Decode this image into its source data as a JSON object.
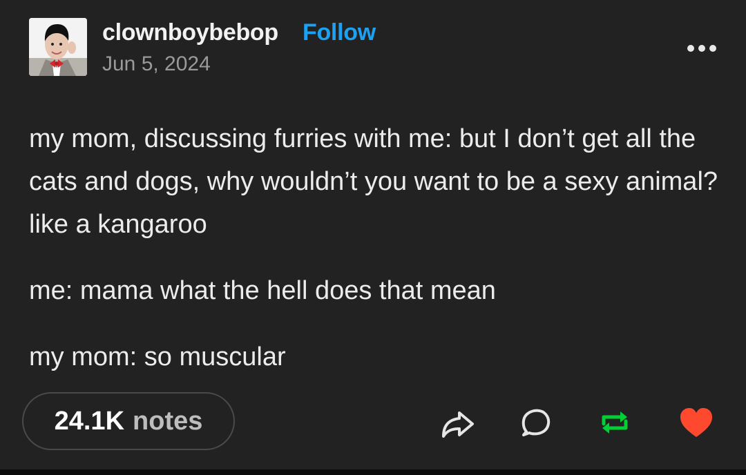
{
  "post": {
    "username": "clownboybebop",
    "follow_label": "Follow",
    "date": "Jun 5, 2024",
    "paragraphs": [
      "my mom, discussing furries with me: but I don’t get all the cats and dogs, why wouldn’t you want to be a sexy animal? like a kangaroo",
      "me: mama what the hell does that mean",
      "my mom: so muscular"
    ]
  },
  "footer": {
    "notes_count": "24.1K",
    "notes_label": "notes"
  },
  "icons": {
    "more": "more-options-icon",
    "share": "share-icon",
    "reply": "reply-icon",
    "reblog": "reblog-icon",
    "like": "heart-icon"
  },
  "colors": {
    "background": "#222222",
    "follow": "#1da1f2",
    "reblog_active": "#00cf35",
    "like_active": "#ff492f"
  }
}
